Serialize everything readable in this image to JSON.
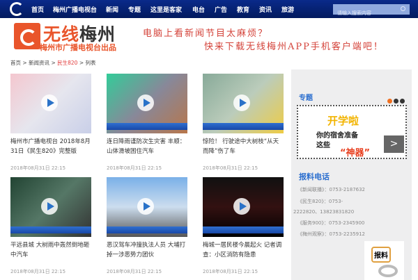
{
  "nav": {
    "items": [
      "首页",
      "梅州广播电视台",
      "新闻",
      "专题",
      "这里是客家",
      "电台",
      "广告",
      "教育",
      "资讯",
      "旅游"
    ],
    "search_placeholder": "请输入搜索内容"
  },
  "header": {
    "brand_a": "无线",
    "brand_b": "梅州",
    "brand_sub": "梅州市广播电视台出品",
    "slogan1": "电脑上看新闻节目太麻烦？",
    "slogan2": "快来下载无线梅州APP手机客户端吧！"
  },
  "breadcrumb": {
    "home": "首页",
    "sep": " > ",
    "news": "新闻资讯",
    "section": "民生820",
    "list": "列表"
  },
  "cards": [
    {
      "title": "梅州市广播电视台 2018年8月31日《民生820》完整版",
      "date": "2018年08月31日 22:15"
    },
    {
      "title": "连日降雨谨防次生灾害 丰顺：山体滑坡困住汽车",
      "date": "2018年08月31日 22:15"
    },
    {
      "title": "惊险！ 行驶途中大树枝“从天而降”伤了车",
      "date": "2018年08月31日 22:15"
    },
    {
      "title": "平远县城 大树雨中轰然倒地砸中汽车",
      "date": "2018年08月31日 22:15"
    },
    {
      "title": "恶汉驾车冲撞执法人员 大埔打掉一涉恶势力团伙",
      "date": "2018年08月31日 22:15"
    },
    {
      "title": "梅城一居民楼今晨起火 记者调查：小区消防有隐患",
      "date": "2018年08月31日 22:15"
    }
  ],
  "sidebar": {
    "topic_heading": "专题",
    "banner": {
      "l1": "开学啦",
      "l2": "你的宿舍准备",
      "l3": "这些",
      "l4": "“神器”"
    },
    "next_label": ">",
    "hotline_heading": "报料电话",
    "hotlines": [
      "《新闻联播》：0753-2187632",
      "《民生820》：0753-",
      "2222820、13823831820",
      "《服务900》：0753-2345900",
      "《梅州观察》：0753-2235912"
    ],
    "baoliao": "报料"
  }
}
